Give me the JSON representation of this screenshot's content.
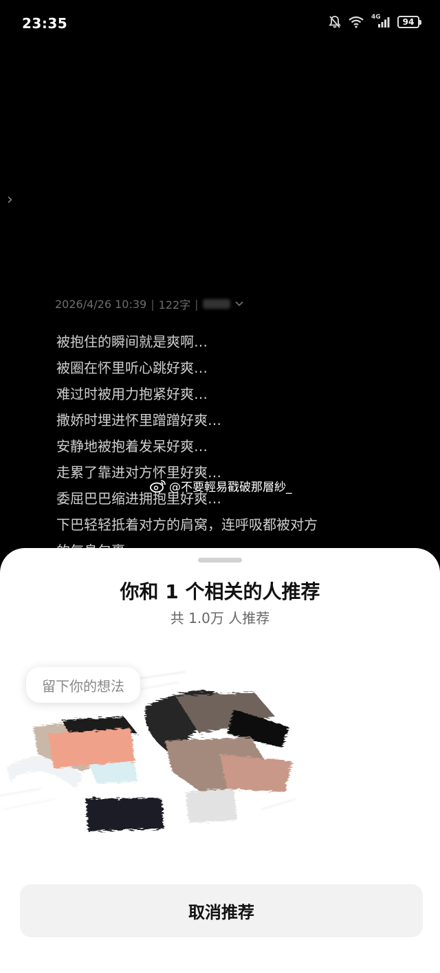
{
  "status_bar": {
    "time": "23:35",
    "battery": "94",
    "network": "4G",
    "icons": [
      "mute-bell-icon",
      "wifi-icon",
      "signal-icon",
      "battery-icon"
    ]
  },
  "note": {
    "date": "2026/4/26 10:39",
    "word_count": "122字",
    "lines": [
      "被抱住的瞬间就是爽啊…",
      "被圈在怀里听心跳好爽…",
      "难过时被用力抱紧好爽…",
      "撒娇时埋进怀里蹭蹭好爽…",
      "安静地被抱着发呆好爽…",
      "走累了靠进对方怀里好爽…",
      "委屈巴巴缩进拥抱里好爽…",
      "下巴轻轻抵着对方的肩窝，连呼吸都被对方",
      "的气息包裹"
    ]
  },
  "watermark": {
    "text": "@不要輕易戳破那層紗_"
  },
  "sheet": {
    "title": "你和 1 个相关的人推荐",
    "subtitle": "共 1.0万 人推荐",
    "bubble": "留下你的想法",
    "cancel_label": "取消推荐"
  },
  "colors": {
    "background": "#000000",
    "sheet_bg": "#ffffff",
    "button_bg": "#f2f2f2"
  }
}
